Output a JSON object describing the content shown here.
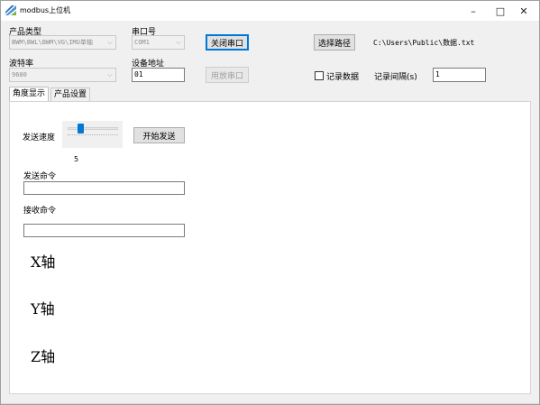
{
  "window": {
    "title": "modbus上位机",
    "controls": {
      "minimize": "–",
      "maximize": "□",
      "close": "✕"
    }
  },
  "product_type": {
    "label": "产品类型",
    "value": "BWM\\BWL\\BWM\\VG\\IMU单轴"
  },
  "baud_rate": {
    "label": "波特率",
    "value": "9600"
  },
  "serial_port": {
    "label": "串口号",
    "value": "COM1"
  },
  "device_address": {
    "label": "设备地址",
    "value": "01"
  },
  "buttons": {
    "close_port": "关闭串口",
    "open_port": "用放串口",
    "select_path": "选择路径",
    "start_send": "开始发送"
  },
  "record": {
    "path": "C:\\Users\\Public\\数据.txt",
    "checkbox_label": "记录数据",
    "checked": false,
    "interval_label": "记录间隔(s)",
    "interval_value": "1"
  },
  "tabs": [
    {
      "label": "角度显示",
      "active": true
    },
    {
      "label": "产品设置",
      "active": false
    }
  ],
  "angle_display": {
    "send_speed_label": "发送速度",
    "send_speed_value": "5",
    "send_cmd_label": "发送命令",
    "send_cmd_value": "",
    "recv_cmd_label": "接收命令",
    "recv_cmd_value": "",
    "x_axis": "X轴",
    "y_axis": "Y轴",
    "z_axis": "Z轴"
  },
  "colors": {
    "accent": "#0078d7",
    "disabled_text": "#a0a0a0"
  },
  "icons": {
    "app": "app-logo-icon",
    "combo_chevron": "chevron-down-icon"
  }
}
